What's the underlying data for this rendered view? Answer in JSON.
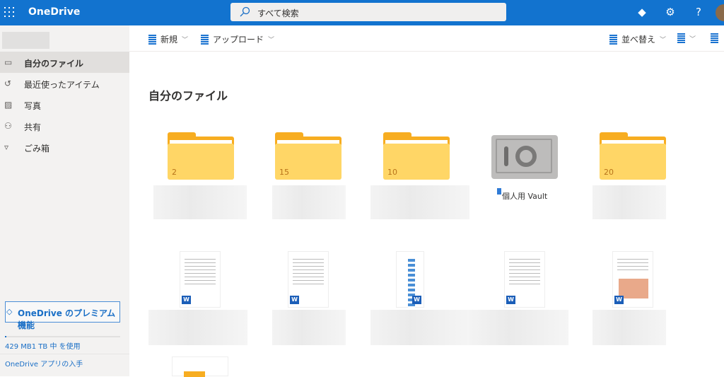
{
  "header": {
    "app_name": "OneDrive",
    "search_placeholder": "すべて検索",
    "icons": [
      "waffle-icon",
      "diamond-icon",
      "gear-icon",
      "help-icon",
      "avatar"
    ]
  },
  "sidebar": {
    "items": [
      {
        "label": "自分のファイル",
        "icon": "folder-icon",
        "selected": true
      },
      {
        "label": "最近使ったアイテム",
        "icon": "history-icon"
      },
      {
        "label": "写真",
        "icon": "photo-icon"
      },
      {
        "label": "共有",
        "icon": "people-icon"
      },
      {
        "label": "ごみ箱",
        "icon": "trash-icon"
      }
    ],
    "premium_label": "OneDrive のプレミアム機能",
    "usage_text": "429 MB1 TB 中 を使用",
    "usage_fraction": 0.0004,
    "get_app": "OneDrive アプリの入手"
  },
  "commands": {
    "new": "新規",
    "upload": "アップロード",
    "sort": "並べ替え"
  },
  "main": {
    "title": "自分のファイル",
    "folders": [
      {
        "count": "2"
      },
      {
        "count": "15"
      },
      {
        "count": "10"
      },
      {
        "count": "20"
      }
    ],
    "vault_label": "個人用 Vault",
    "word_badge": "W"
  }
}
